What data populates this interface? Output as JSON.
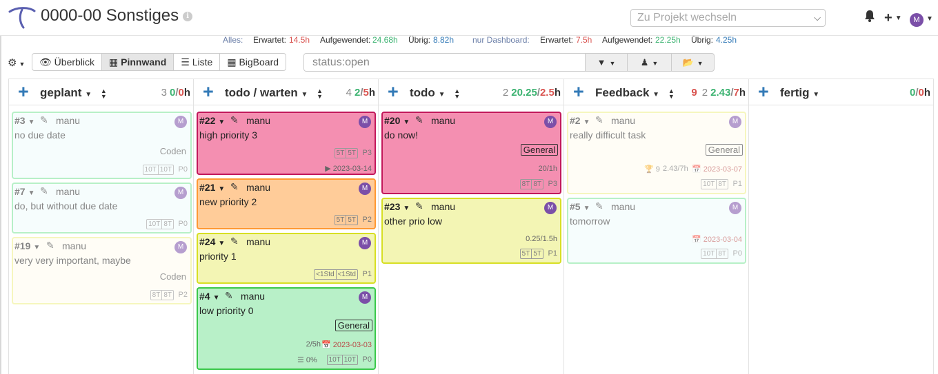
{
  "header": {
    "title": "0000-00 Sonstiges",
    "info_icon": "info-icon",
    "project_switch_placeholder": "Zu Projekt wechseln",
    "user_initial": "M"
  },
  "stats": {
    "all_label": "Alles:",
    "expected_label": "Erwartet:",
    "spent_label": "Aufgewendet:",
    "remaining_label": "Übrig:",
    "all_expected": "14.5h",
    "all_spent": "24.68h",
    "all_remaining": "8.82h",
    "dashboard_label": "nur Dashboard:",
    "dash_expected": "7.5h",
    "dash_spent": "22.25h",
    "dash_remaining": "4.25h"
  },
  "views": [
    {
      "label": "Überblick",
      "icon": "eye-icon",
      "active": false
    },
    {
      "label": "Pinnwand",
      "icon": "grid-icon",
      "active": true
    },
    {
      "label": "Liste",
      "icon": "list-icon",
      "active": false
    },
    {
      "label": "BigBoard",
      "icon": "grid-icon",
      "active": false
    }
  ],
  "filter": {
    "value": "status:open"
  },
  "columns": [
    {
      "title": "geplant",
      "count": "3",
      "green": "0",
      "red": "0",
      "alert": "",
      "cards": [
        {
          "id": "#3",
          "user": "manu",
          "title": "no due date",
          "tag": "Coden",
          "chip1": "10T",
          "chip2": "10T",
          "prio": "P0"
        },
        {
          "id": "#7",
          "user": "manu",
          "title": "do, but without due date",
          "chip1": "10T",
          "chip2": "8T",
          "prio": "P0"
        },
        {
          "id": "#19",
          "user": "manu",
          "title": "very very important, maybe",
          "tag": "Coden",
          "chip1": "8T",
          "chip2": "8T",
          "prio": "P2"
        }
      ]
    },
    {
      "title": "todo / warten",
      "count": "4",
      "green": "2",
      "red": "5",
      "alert": "",
      "cards": [
        {
          "id": "#22",
          "user": "manu",
          "title": "high priority 3",
          "chip1": "5T",
          "chip2": "5T",
          "prio": "P3",
          "start_date": "2023-03-14"
        },
        {
          "id": "#21",
          "user": "manu",
          "title": "new priority 2",
          "chip1": "5T",
          "chip2": "5T",
          "prio": "P2"
        },
        {
          "id": "#24",
          "user": "manu",
          "title": "priority 1",
          "chip1": "<1Std",
          "chip2": "<1Std",
          "prio": "P1"
        },
        {
          "id": "#4",
          "user": "manu",
          "title": "low priority 0",
          "tag": "General",
          "estimate": "2/5h",
          "due": "2023-03-03",
          "progress": "0%",
          "chip1": "10T",
          "chip2": "10T",
          "prio": "P0"
        }
      ]
    },
    {
      "title": "todo",
      "count": "2",
      "green": "20.25",
      "red": "2.5",
      "alert": "",
      "cards": [
        {
          "id": "#20",
          "user": "manu",
          "title": "do now!",
          "tag": "General",
          "estimate": "20/1h",
          "chip1": "8T",
          "chip2": "8T",
          "prio": "P3"
        },
        {
          "id": "#23",
          "user": "manu",
          "title": "other prio low",
          "estimate": "0.25/1.5h",
          "chip1": "5T",
          "chip2": "5T",
          "prio": "P1"
        }
      ]
    },
    {
      "title": "Feedback",
      "count": "2",
      "green": "2.43",
      "red": "7",
      "alert": "9",
      "cards": [
        {
          "id": "#2",
          "user": "manu",
          "title": "really difficult task",
          "tag": "General",
          "trophy": "9",
          "ratio": "2.43/7h",
          "due": "2023-03-07",
          "chip1": "10T",
          "chip2": "8T",
          "prio": "P1"
        },
        {
          "id": "#5",
          "user": "manu",
          "title": "tomorrow",
          "due": "2023-03-04",
          "chip1": "10T",
          "chip2": "8T",
          "prio": "P0"
        }
      ]
    },
    {
      "title": "fertig",
      "count": "",
      "green": "0",
      "red": "0",
      "alert": "",
      "cards": []
    }
  ],
  "unit_h": "h",
  "slash": "/",
  "colors": {
    "accent": "#337ab7",
    "pink_bg": "#f48fb1",
    "pink_border": "#c2185b",
    "orange_bg": "#ffcc99",
    "orange_border": "#ff9933",
    "yellow_bg": "#f3f5b4",
    "yellow_border": "#d7df23",
    "green_bg": "#b8f0c8",
    "green_border": "#3ac84a",
    "cyan_bg": "#f0fcfc",
    "cyan_border": "#7ee49a",
    "paleyellow_bg": "#fffdf0",
    "paleyellow_border": "#f0f08a"
  }
}
